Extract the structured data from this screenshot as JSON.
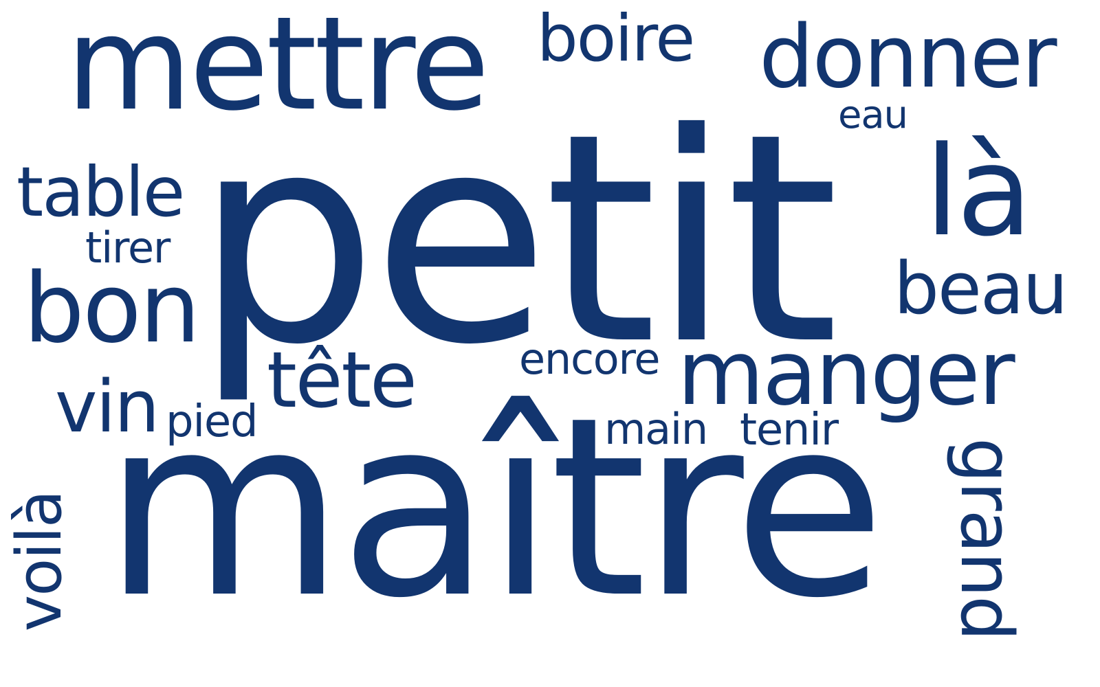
{
  "word_cloud": {
    "color": "#12356f",
    "words": {
      "mettre": "mettre",
      "boire": "boire",
      "donner": "donner",
      "eau": "eau",
      "petit": "petit",
      "la": "là",
      "table": "table",
      "tirer": "tirer",
      "bon": "bon",
      "beau": "beau",
      "tete": "tête",
      "encore": "encore",
      "manger": "manger",
      "vin": "vin",
      "pied": "pied",
      "main": "main",
      "tenir": "tenir",
      "maitre": "maître",
      "voila": "voilà",
      "grand": "grand"
    }
  }
}
